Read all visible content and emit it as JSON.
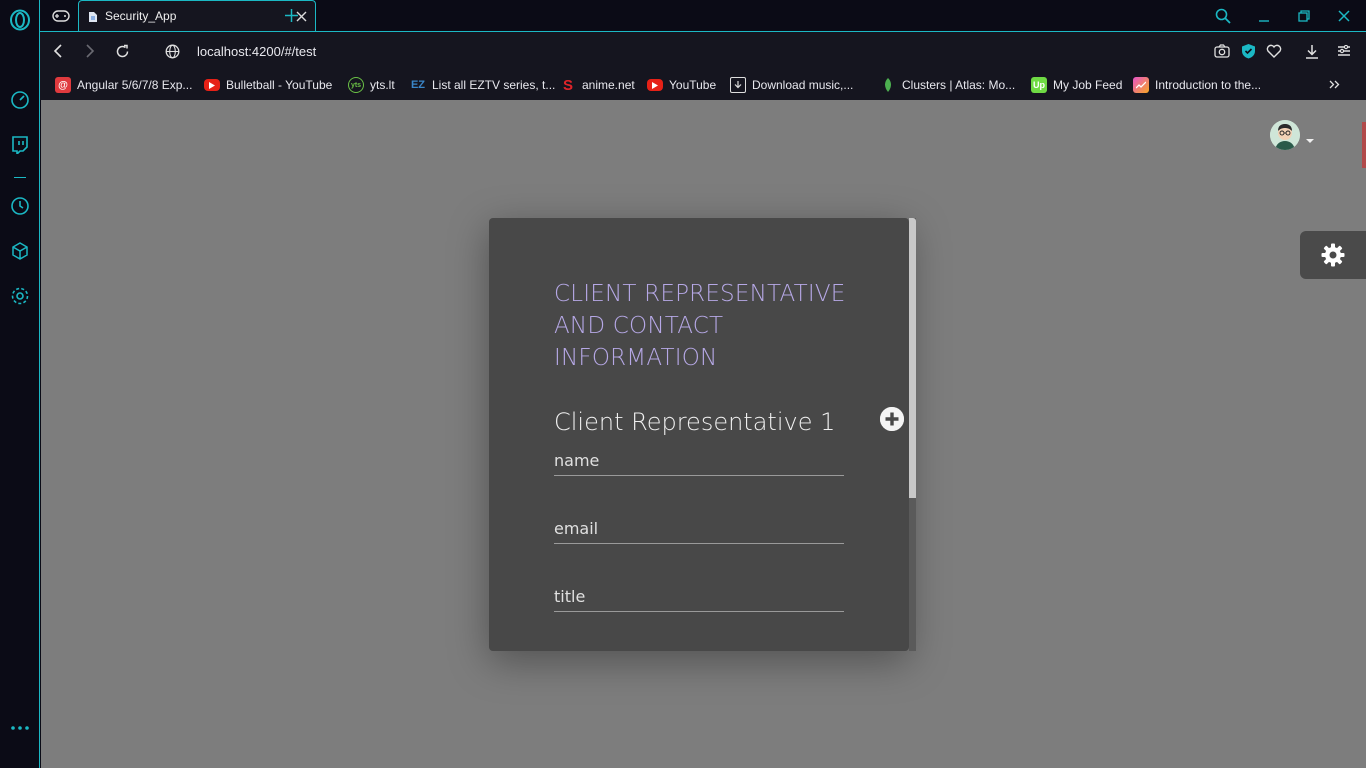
{
  "browser": {
    "tab_title": "Security_App",
    "url": "localhost:4200/#/test",
    "accent_color": "#1bb8c4"
  },
  "bookmarks": [
    {
      "label": "Angular 5/6/7/8 Exp...",
      "icon": "at-icon",
      "color": "#e03a3e"
    },
    {
      "label": "Bulletball - YouTube",
      "icon": "youtube-icon",
      "color": "#e62117"
    },
    {
      "label": "yts.lt",
      "icon": "yts-icon",
      "color": "#6ac045"
    },
    {
      "label": "List all EZTV series, t...",
      "icon": "eztv-icon",
      "color": "#3a86c8"
    },
    {
      "label": "anime.net",
      "icon": "s-logo-icon",
      "color": "#e0242a"
    },
    {
      "label": "YouTube",
      "icon": "youtube-icon",
      "color": "#e62117"
    },
    {
      "label": "Download music,...",
      "icon": "download-icon",
      "color": "#dddddd"
    },
    {
      "label": "Clusters | Atlas: Mo...",
      "icon": "leaf-icon",
      "color": "#4caf50"
    },
    {
      "label": "My Job Feed",
      "icon": "upwork-icon",
      "color": "#6fda44"
    },
    {
      "label": "Introduction to the...",
      "icon": "chart-icon",
      "color": "#e754c9"
    }
  ],
  "card": {
    "title": "CLIENT REPRESENTATIVE AND CONTACT INFORMATION",
    "rep_heading": "Client Representative 1",
    "fields": {
      "name_placeholder": "name",
      "email_placeholder": "email",
      "title_placeholder": "title"
    },
    "title_color": "#b6a8e6"
  }
}
